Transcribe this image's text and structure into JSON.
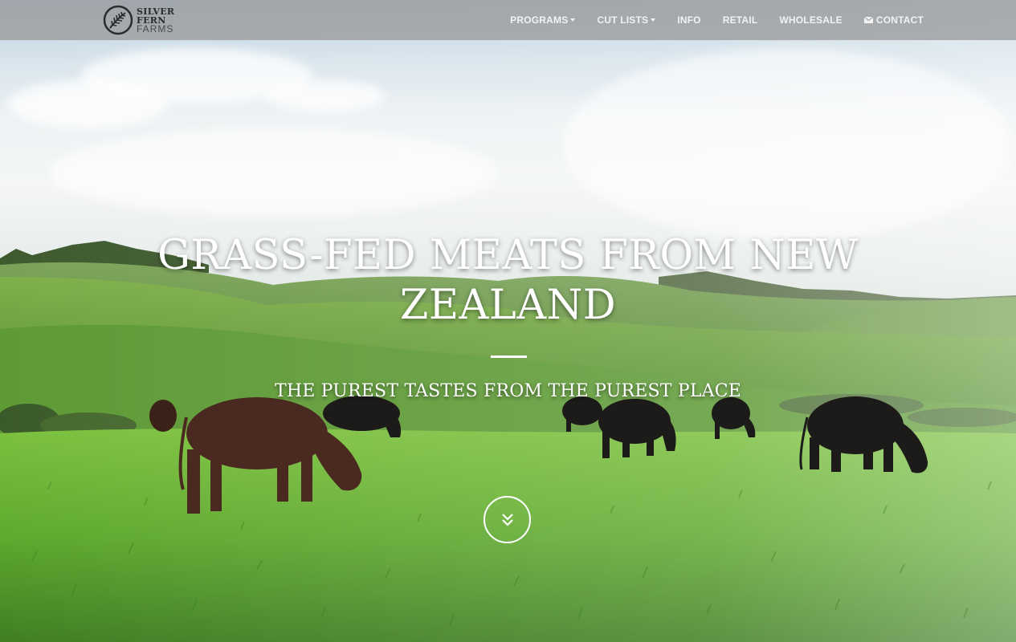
{
  "brand": {
    "line1": "SILVER",
    "line2": "FERN",
    "line3": "FARMS",
    "logo_icon": "silver-fern-icon"
  },
  "nav": {
    "items": [
      {
        "label": "PROGRAMS",
        "dropdown": true
      },
      {
        "label": "CUT LISTS",
        "dropdown": true
      },
      {
        "label": "INFO",
        "dropdown": false
      },
      {
        "label": "RETAIL",
        "dropdown": false
      },
      {
        "label": "WHOLESALE",
        "dropdown": false
      },
      {
        "label": "CONTACT",
        "dropdown": false,
        "icon": "envelope-icon"
      }
    ]
  },
  "hero": {
    "headline_line1": "GRASS-FED MEATS FROM NEW",
    "headline_line2": "ZEALAND",
    "tagline": "THE PUREST TASTES FROM THE PUREST PLACE",
    "scroll_icon": "double-chevron-down-icon"
  },
  "colors": {
    "navbar_bg": "#969696",
    "text": "#ffffff",
    "grass": "#6cae3a"
  }
}
